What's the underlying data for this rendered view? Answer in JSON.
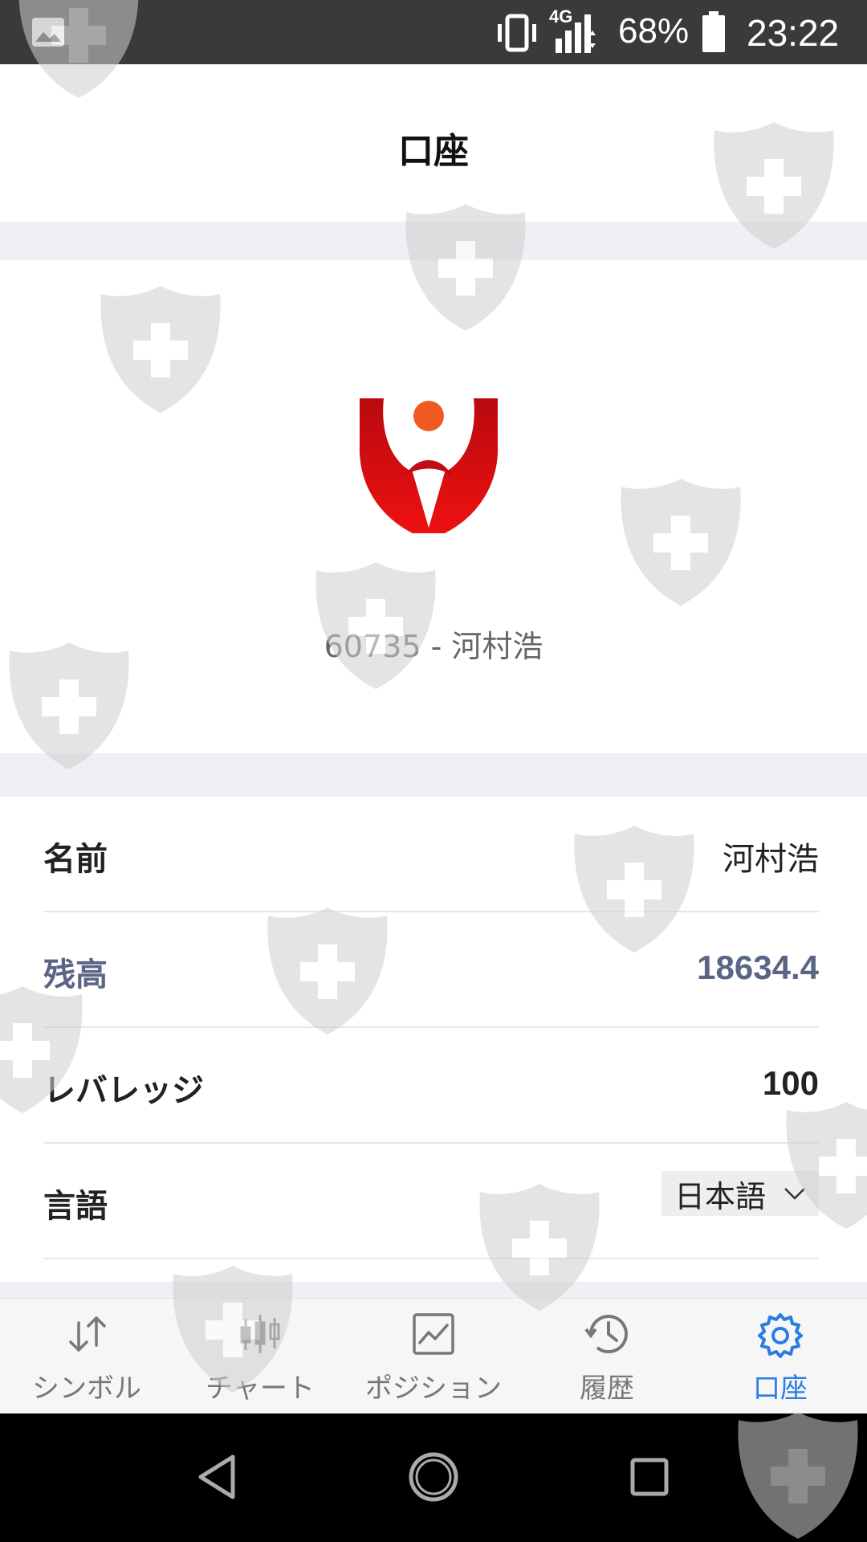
{
  "status_bar": {
    "network": "4G",
    "battery_percent": "68%",
    "time": "23:22"
  },
  "header": {
    "title": "口座"
  },
  "profile": {
    "account_line": "60735 - 河村浩"
  },
  "info": {
    "name_label": "名前",
    "name_value": "河村浩",
    "balance_label": "残高",
    "balance_value": "18634.4",
    "leverage_label": "レバレッジ",
    "leverage_value": "100",
    "language_label": "言語",
    "language_value": "日本語"
  },
  "bottom_nav": {
    "items": [
      {
        "label": "シンボル",
        "icon": "swap-arrows-icon"
      },
      {
        "label": "チャート",
        "icon": "candlestick-icon"
      },
      {
        "label": "ポジション",
        "icon": "line-chart-icon"
      },
      {
        "label": "履歴",
        "icon": "history-clock-icon"
      },
      {
        "label": "口座",
        "icon": "gear-icon"
      }
    ],
    "active_index": 4
  },
  "colors": {
    "accent": "#2a7de1",
    "balance_text": "#5a6485",
    "logo_red": "#d40f14",
    "logo_dot": "#f05a22"
  }
}
